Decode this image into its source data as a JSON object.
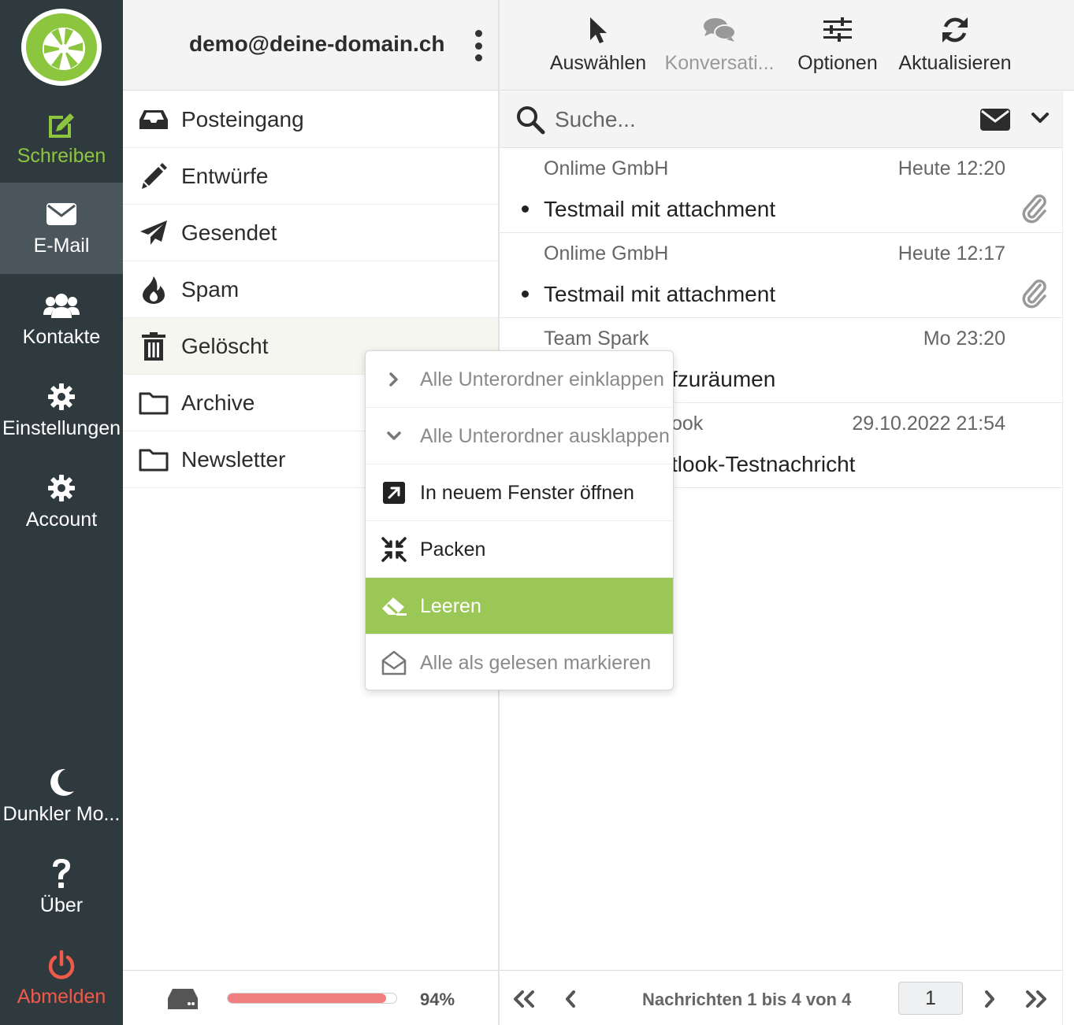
{
  "nav": {
    "items": [
      {
        "label": "Schreiben",
        "icon": "compose-icon"
      },
      {
        "label": "E-Mail",
        "icon": "envelope-icon"
      },
      {
        "label": "Kontakte",
        "icon": "contacts-icon"
      },
      {
        "label": "Einstellungen",
        "icon": "gear-icon"
      },
      {
        "label": "Account",
        "icon": "gear-icon"
      },
      {
        "label": "Dunkler Mo...",
        "icon": "moon-icon"
      },
      {
        "label": "Über",
        "icon": "question-icon"
      },
      {
        "label": "Abmelden",
        "icon": "power-icon"
      }
    ]
  },
  "account": {
    "name": "demo@deine-domain.ch"
  },
  "folders": [
    {
      "label": "Posteingang",
      "icon": "inbox-icon"
    },
    {
      "label": "Entwürfe",
      "icon": "pencil-icon"
    },
    {
      "label": "Gesendet",
      "icon": "paper-plane-icon"
    },
    {
      "label": "Spam",
      "icon": "fire-icon"
    },
    {
      "label": "Gelöscht",
      "icon": "trash-icon"
    },
    {
      "label": "Archive",
      "icon": "folder-icon"
    },
    {
      "label": "Newsletter",
      "icon": "folder-icon"
    }
  ],
  "quota": {
    "percent_label": "94%",
    "fraction": 0.94
  },
  "toolbar": {
    "select": "Auswählen",
    "threads": "Konversati...",
    "options": "Optionen",
    "refresh": "Aktualisieren"
  },
  "search": {
    "placeholder": "Suche..."
  },
  "messages": [
    {
      "from": "Onlime GmbH",
      "date": "Heute 12:20",
      "subject": "Testmail mit attachment",
      "unread": true,
      "attachment": true
    },
    {
      "from": "Onlime GmbH",
      "date": "Heute 12:17",
      "subject": "Testmail mit attachment",
      "unread": true,
      "attachment": true
    },
    {
      "from": "Team Spark",
      "date": "Mo 23:20",
      "subject": "fzuräumen",
      "unread": false,
      "attachment": false
    },
    {
      "from": "ook",
      "date": "29.10.2022 21:54",
      "subject": "tlook-Testnachricht",
      "unread": false,
      "attachment": false
    }
  ],
  "pagination": {
    "count": "Nachrichten 1 bis 4 von 4",
    "page": "1"
  },
  "context_menu": [
    {
      "label": "Alle Unterordner einklappen",
      "icon": "chevron-right-icon",
      "state": "disabled"
    },
    {
      "label": "Alle Unterordner ausklappen",
      "icon": "chevron-down-icon",
      "state": "disabled"
    },
    {
      "label": "In neuem Fenster öffnen",
      "icon": "external-window-icon",
      "state": "normal"
    },
    {
      "label": "Packen",
      "icon": "compress-icon",
      "state": "normal"
    },
    {
      "label": "Leeren",
      "icon": "eraser-icon",
      "state": "highlight"
    },
    {
      "label": "Alle als gelesen markieren",
      "icon": "envelope-open-icon",
      "state": "disabled"
    }
  ],
  "colors": {
    "accent": "#8cc63f",
    "nav_bg": "#2f3a3f",
    "danger": "#ef5a4a",
    "highlight": "#9bc757"
  }
}
